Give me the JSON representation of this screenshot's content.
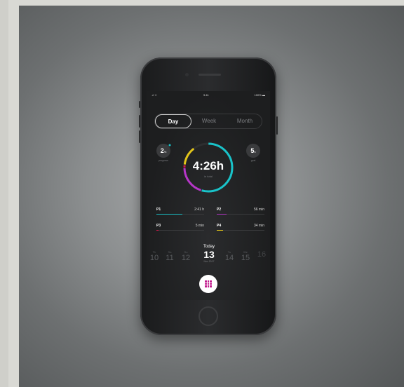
{
  "status_bar": {
    "signal": ".ıl ᯤ",
    "time": "9:41",
    "battery": "100%"
  },
  "tabs": [
    {
      "label": "Day",
      "active": true
    },
    {
      "label": "Week",
      "active": false
    },
    {
      "label": "Month",
      "active": false
    }
  ],
  "progress": {
    "value": "2",
    "unit": "%",
    "label": "progress"
  },
  "goal": {
    "value": "5",
    "unit": "h",
    "label": "goal"
  },
  "total": {
    "value": "4:26h",
    "label": "in total"
  },
  "projects": [
    {
      "name": "P1",
      "time": "2:41 h",
      "fraction": 0.55,
      "color": "#19c3c9"
    },
    {
      "name": "P2",
      "time": "56 min",
      "fraction": 0.2,
      "color": "#b636c8"
    },
    {
      "name": "P3",
      "time": "5 min",
      "fraction": 0.02,
      "color": "#d4164a"
    },
    {
      "name": "P4",
      "time": "34 min",
      "fraction": 0.13,
      "color": "#e2c51a"
    }
  ],
  "dates": [
    {
      "weekday": "Th",
      "day": "10",
      "today": false
    },
    {
      "weekday": "Sa",
      "day": "11",
      "today": false
    },
    {
      "weekday": "Su",
      "day": "12",
      "today": false
    },
    {
      "weekday": "Today",
      "day": "13",
      "month": "Nov 2017",
      "today": true
    },
    {
      "weekday": "Tu",
      "day": "14",
      "today": false
    },
    {
      "weekday": "We",
      "day": "15",
      "today": false
    },
    {
      "weekday": "",
      "day": "16",
      "today": false
    }
  ],
  "fab": {
    "icon": "grid-icon",
    "color": "#c21d8e"
  }
}
